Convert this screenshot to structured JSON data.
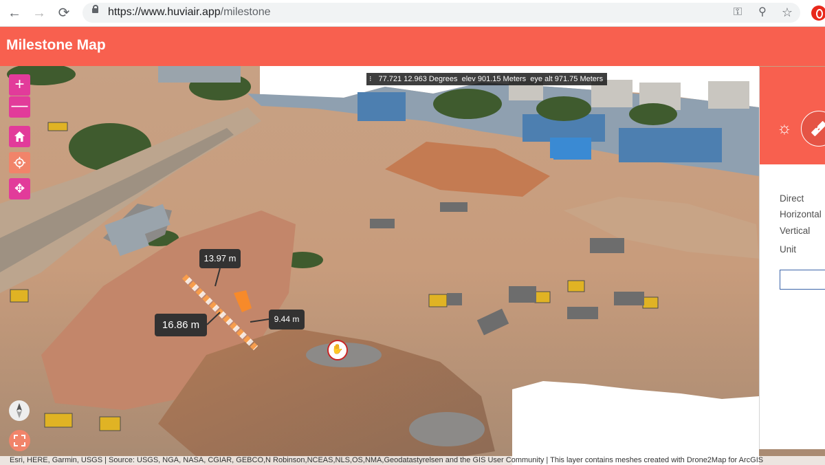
{
  "browser": {
    "url_host": "https://www.huviair.app",
    "url_path": "/milestone",
    "icons": [
      "back-arrow-icon",
      "forward-arrow-icon",
      "reload-icon",
      "lock-icon",
      "key-icon",
      "zoom-icon",
      "star-icon",
      "opera-icon"
    ]
  },
  "header": {
    "title": "Milestone Map"
  },
  "map": {
    "coordinates": "77.721 12.963 Degrees",
    "elevation": "elev 901.15 Meters",
    "eye_altitude": "eye alt 971.75 Meters",
    "tools": {
      "zoom_in": "+",
      "zoom_out": "—",
      "pan": "✥"
    },
    "measurements": {
      "upper": "13.97 m",
      "direct": "16.86 m",
      "side": "9.44 m"
    },
    "attribution": "Esri, HERE, Garmin, USGS | Source: USGS, NGA, NASA, CGIAR, GEBCO,N Robinson,NCEAS,NLS,OS,NMA,Geodatastyrelsen and the GIS User Community | This layer contains meshes created with Drone2Map for ArcGIS"
  },
  "panel": {
    "labels": {
      "direct": "Direct",
      "horizontal": "Horizontal",
      "vertical": "Vertical",
      "unit": "Unit"
    },
    "unit_value": "",
    "icons": [
      "sun-icon",
      "ruler-icon"
    ]
  },
  "colors": {
    "brand": "#f8604f",
    "tool_pink": "#e23b9a",
    "tool_coral": "#f1846a"
  }
}
